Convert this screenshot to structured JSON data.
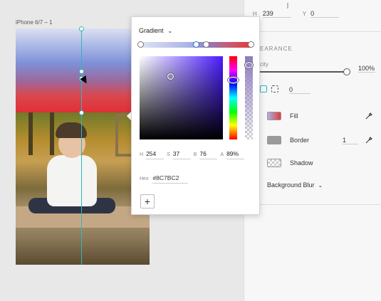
{
  "artboard": {
    "label": "iPhone 6/7 – 1"
  },
  "gradient_editor": {
    "type_label": "Gradient",
    "stops": [
      0.0,
      0.45,
      0.6,
      1.0
    ],
    "selected_stop": 0.45
  },
  "color": {
    "h_label": "H",
    "h": "254",
    "s_label": "S",
    "s": "37",
    "b_label": "B",
    "b": "76",
    "a_label": "A",
    "a": "89%",
    "hex_label": "Hex",
    "hex": "#8C7BC2",
    "sv_x": 0.37,
    "sv_y": 0.24,
    "hue_pos": 0.29,
    "alpha_pos": 0.11,
    "add_label": "+"
  },
  "panel": {
    "h_label": "H",
    "h": "239",
    "y_label": "Y",
    "y": "0",
    "appearance_label": "EARANCE",
    "opacity_label": "city",
    "opacity_value": "100%",
    "radius_value": "0",
    "fill_label": "Fill",
    "border_label": "Border",
    "border_value": "1",
    "shadow_label": "Shadow",
    "bg_blur_label": "Background Blur"
  },
  "colors": {
    "accent": "#2bb7bf",
    "fill_start": "#a7b2e6",
    "fill_end": "#e33a3a",
    "border_swatch": "#9a9a9a"
  }
}
